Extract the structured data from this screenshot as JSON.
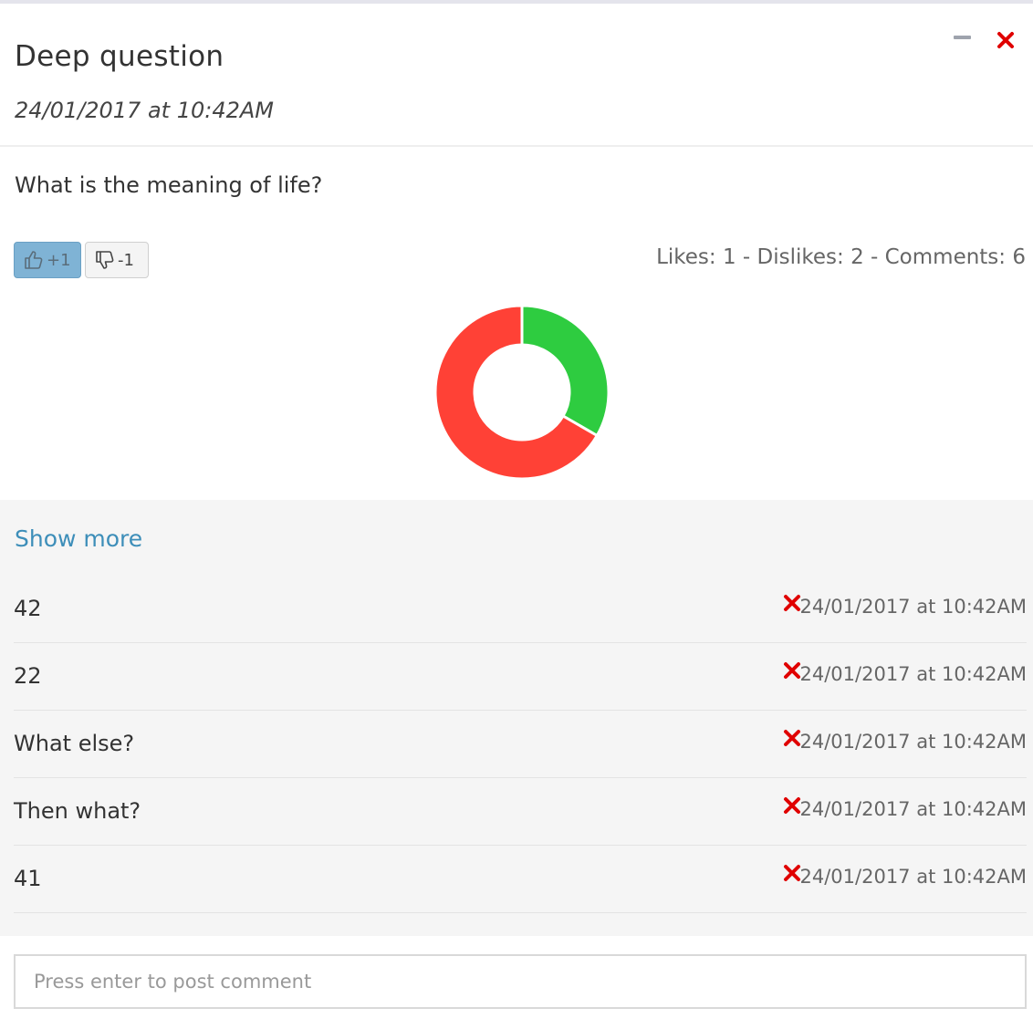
{
  "post": {
    "title": "Deep question",
    "date": "24/01/2017 at 10:42AM",
    "question": "What is the meaning of life?"
  },
  "window_controls": {
    "minimize_icon": "minus-icon",
    "close_icon": "close-x-icon",
    "close_color": "#e00000"
  },
  "votes": {
    "like_label": "+1",
    "like_icon": "thumbs-up-icon",
    "dislike_label": "-1",
    "dislike_icon": "thumbs-down-icon",
    "stats": "Likes: 1 - Dislikes: 2 - Comments: 6"
  },
  "chart_data": {
    "type": "pie",
    "variant": "donut",
    "slices": [
      {
        "value": 1,
        "color": "#2ecc40"
      },
      {
        "value": 2,
        "color": "#ff4136"
      }
    ]
  },
  "comments": {
    "show_more": "Show more",
    "delete_icon": "close-x-icon",
    "items": [
      {
        "text": "42",
        "date": "24/01/2017 at 10:42AM"
      },
      {
        "text": "22",
        "date": "24/01/2017 at 10:42AM"
      },
      {
        "text": "What else?",
        "date": "24/01/2017 at 10:42AM"
      },
      {
        "text": "Then what?",
        "date": "24/01/2017 at 10:42AM"
      },
      {
        "text": "41",
        "date": "24/01/2017 at 10:42AM"
      }
    ]
  },
  "composer": {
    "placeholder": "Press enter to post comment"
  },
  "colors": {
    "accent_link": "#3d8eb9",
    "like_button": "#7fb3d5",
    "delete": "#e00000"
  }
}
